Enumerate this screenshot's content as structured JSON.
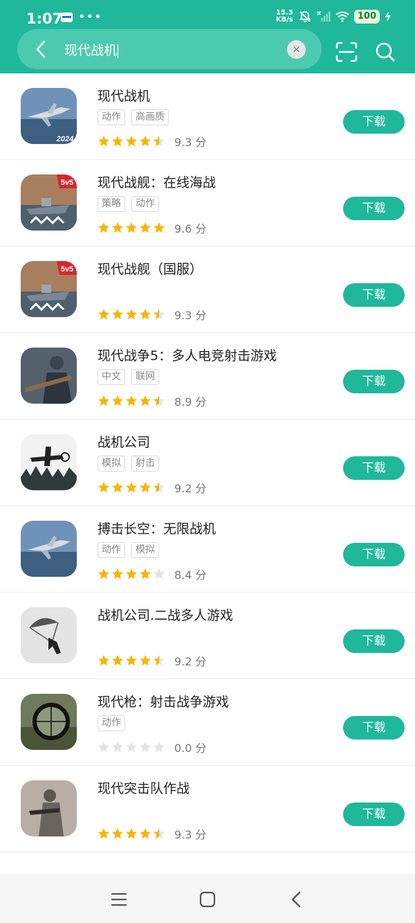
{
  "status_bar": {
    "time": "1:07",
    "net_speed_value": "15.3",
    "net_speed_unit": "KB/s",
    "battery": "100",
    "icons": [
      "wallet-icon",
      "more-dots-icon",
      "mute-bell-icon",
      "no-signal-icon",
      "wifi-icon",
      "charging-icon"
    ]
  },
  "search": {
    "query": "现代战机",
    "clear_label": "×"
  },
  "header_icons": [
    "back-icon",
    "scan-icon",
    "search-icon"
  ],
  "colors": {
    "accent": "#1fb89a",
    "star_filled": "#f7b500",
    "star_empty": "#e3e3e3"
  },
  "apps": [
    {
      "name": "现代战机",
      "tags": [
        "动作",
        "高画质"
      ],
      "rating": 4.5,
      "score": "9.3 分",
      "button": "下载"
    },
    {
      "name": "现代战舰：在线海战",
      "tags": [
        "策略",
        "动作"
      ],
      "rating": 5,
      "score": "9.6 分",
      "button": "下载"
    },
    {
      "name": "现代战舰（国服）",
      "tags": [],
      "rating": 4.5,
      "score": "9.3 分",
      "button": "下载"
    },
    {
      "name": "现代战争5：多人电竞射击游戏",
      "tags": [
        "中文",
        "联网"
      ],
      "rating": 4.5,
      "score": "8.9 分",
      "button": "下载"
    },
    {
      "name": "战机公司",
      "tags": [
        "模拟",
        "射击"
      ],
      "rating": 4.5,
      "score": "9.2 分",
      "button": "下载"
    },
    {
      "name": "搏击长空：无限战机",
      "tags": [
        "动作",
        "模拟"
      ],
      "rating": 4,
      "score": "8.4 分",
      "button": "下载"
    },
    {
      "name": "战机公司.二战多人游戏",
      "tags": [],
      "rating": 4.5,
      "score": "9.2 分",
      "button": "下载"
    },
    {
      "name": "现代枪：射击战争游戏",
      "tags": [
        "动作"
      ],
      "rating": 0,
      "score": "0.0 分",
      "button": "下载"
    },
    {
      "name": "现代突击队作战",
      "tags": [],
      "rating": 4.5,
      "score": "9.3 分",
      "button": "下载"
    }
  ],
  "app_icons": [
    {
      "icon": "jet-fighter-icon",
      "badge": "2024"
    },
    {
      "icon": "warship-icon",
      "badge": "5v5"
    },
    {
      "icon": "warship-icon",
      "badge": "5v5"
    },
    {
      "icon": "soldier-icon",
      "badge": ""
    },
    {
      "icon": "biplane-icon",
      "badge": ""
    },
    {
      "icon": "jet-fighter-icon",
      "badge": ""
    },
    {
      "icon": "paratrooper-icon",
      "badge": ""
    },
    {
      "icon": "scope-icon",
      "badge": ""
    },
    {
      "icon": "commando-icon",
      "badge": ""
    }
  ],
  "nav": [
    "menu-icon",
    "home-icon",
    "back-icon"
  ]
}
